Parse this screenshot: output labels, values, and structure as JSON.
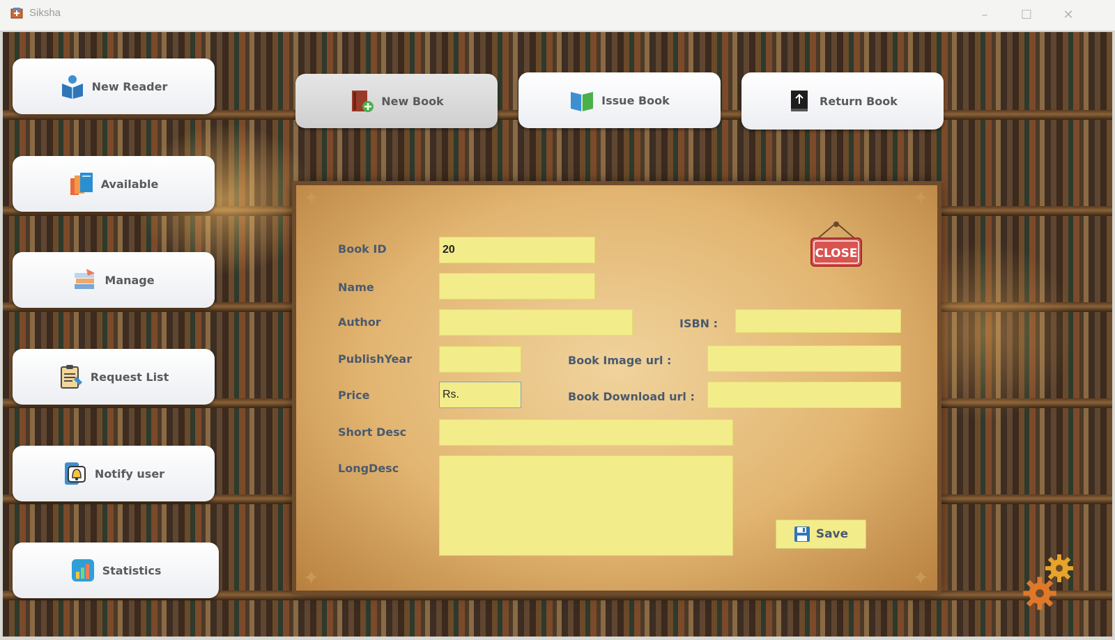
{
  "window": {
    "title": "Siksha",
    "minimize": "–",
    "maximize": "☐",
    "close": "✕"
  },
  "nav": {
    "new_reader": "New Reader",
    "available": "Available",
    "manage": "Manage",
    "request_list": "Request List",
    "notify_user": "Notify user",
    "statistics": "Statistics",
    "new_book": "New Book",
    "issue_book": "Issue Book",
    "return_book": "Return Book"
  },
  "form": {
    "book_id_label": "Book ID",
    "book_id_value": "20",
    "name_label": "Name",
    "name_value": "",
    "author_label": "Author",
    "author_value": "",
    "isbn_label": "ISBN :",
    "isbn_value": "",
    "publish_year_label": "PublishYear",
    "publish_year_value": "",
    "book_image_url_label": "Book Image url :",
    "book_image_url_value": "",
    "price_label": "Price",
    "price_value": "Rs.",
    "book_download_url_label": "Book Download url :",
    "book_download_url_value": "",
    "short_desc_label": "Short Desc",
    "short_desc_value": "",
    "long_desc_label": "LongDesc",
    "long_desc_value": "",
    "close_sign": "CLOSE",
    "save_label": "Save"
  },
  "colors": {
    "field": "#f2ec8b",
    "label": "#4a5a6e",
    "close_red": "#d9534f",
    "gear_orange": "#e8902a"
  },
  "icons": [
    "app-icon",
    "reader-book-icon",
    "books-stack-icon",
    "manage-books-icon",
    "clipboard-icon",
    "notification-bell-icon",
    "statistics-chart-icon",
    "new-book-icon",
    "issue-book-icon",
    "return-book-icon",
    "floppy-disk-icon",
    "gear-icon"
  ]
}
